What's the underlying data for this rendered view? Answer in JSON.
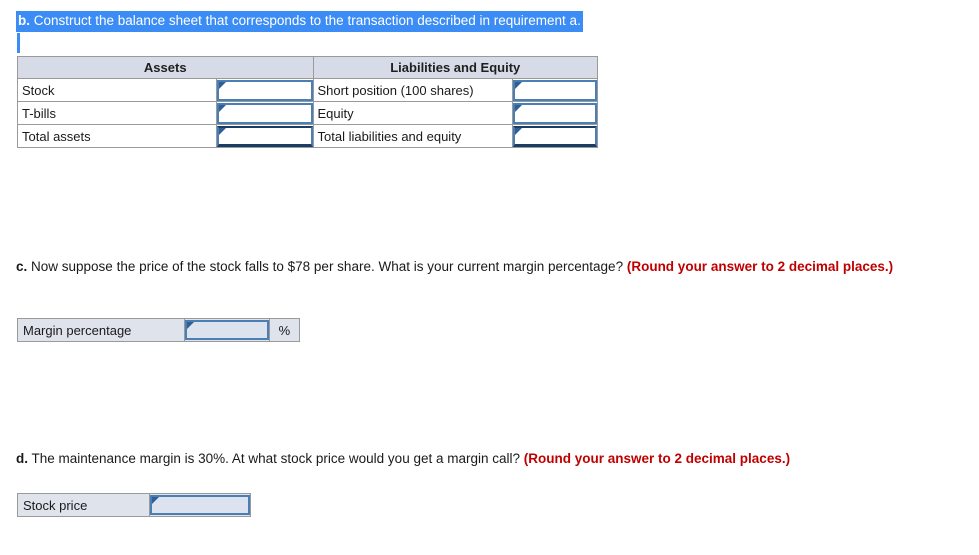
{
  "question_b": {
    "label": "b.",
    "text": " Construct the balance sheet that corresponds to the transaction described in requirement a.",
    "highlight_color": "#3b8cf5"
  },
  "balance_sheet": {
    "headers": [
      "Assets",
      "Liabilities and Equity"
    ],
    "rows": [
      {
        "asset_label": "Stock",
        "asset_value": "",
        "liability_label": "Short position (100 shares)",
        "liability_value": ""
      },
      {
        "asset_label": "T-bills",
        "asset_value": "",
        "liability_label": "Equity",
        "liability_value": ""
      },
      {
        "asset_label": "Total assets",
        "asset_value": "",
        "liability_label": "Total liabilities and equity",
        "liability_value": ""
      }
    ]
  },
  "question_c": {
    "label": "c.",
    "text": " Now suppose the price of the stock falls to $78 per share. What is your current margin percentage? ",
    "note": "(Round your answer to 2 decimal places.)"
  },
  "margin_answer": {
    "label": "Margin percentage",
    "value": "",
    "unit": "%"
  },
  "question_d": {
    "label": "d.",
    "text": " The maintenance margin is 30%. At what stock price would you get a margin call? ",
    "note": "(Round your answer to 2 decimal places.)"
  },
  "stock_price_answer": {
    "label": "Stock price",
    "value": ""
  },
  "colors": {
    "selection_blue": "#3b8cf5",
    "header_fill": "#d6dbe7",
    "input_border": "#4a7fb5",
    "input_marker": "#2f5f96",
    "note_red": "#c00000",
    "mini_fill": "#dfe3ec"
  }
}
